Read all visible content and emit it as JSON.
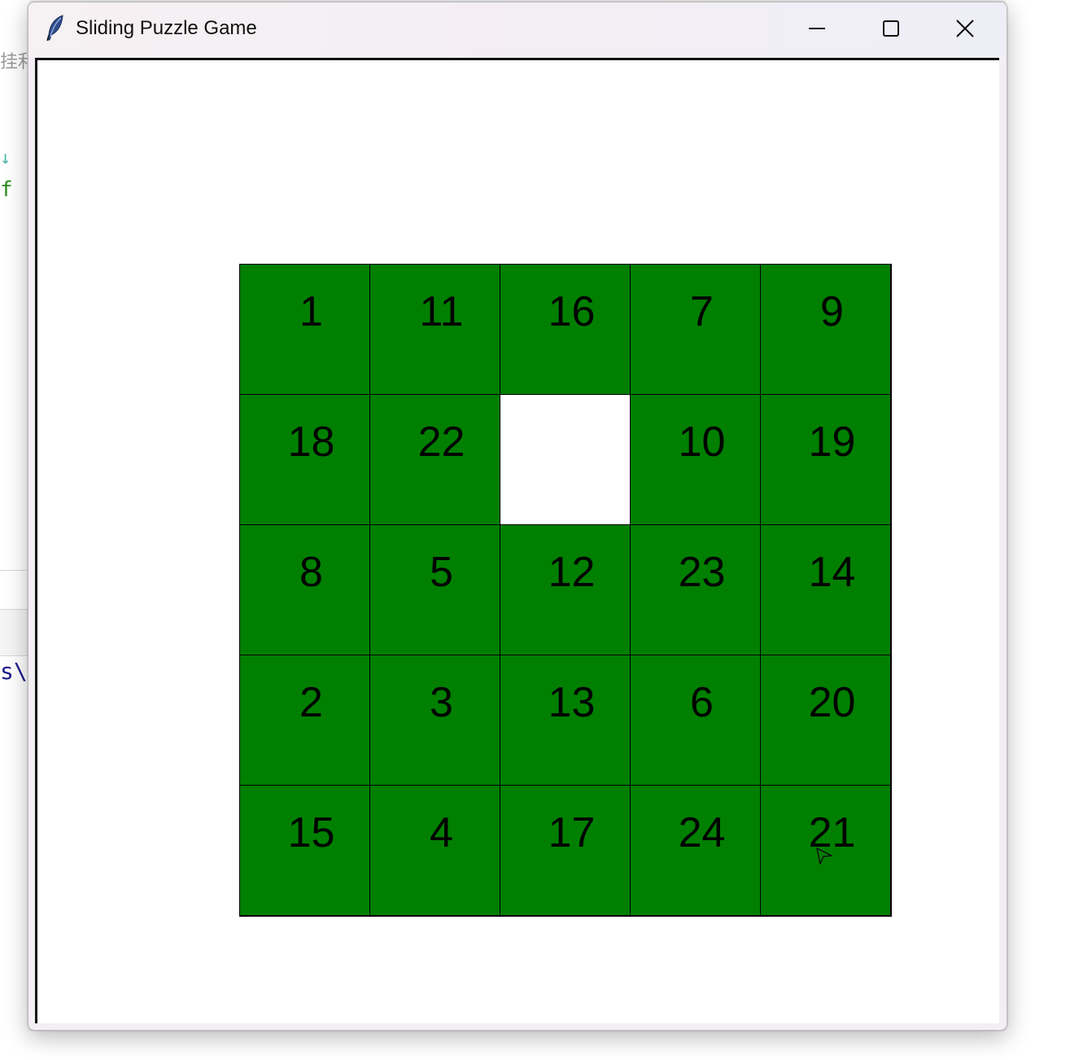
{
  "background": {
    "cjk_fragment": "挂利",
    "arrow_glyph": "↓",
    "code_fragment_f": "f",
    "code_fragment_s": "s\\"
  },
  "window": {
    "title": "Sliding Puzzle Game",
    "app_icon": "feather-icon",
    "controls": {
      "minimize": "minimize-icon",
      "maximize": "maximize-icon",
      "close": "close-icon"
    }
  },
  "puzzle": {
    "rows": 5,
    "cols": 5,
    "tile_color": "#007f00",
    "empty_color": "#ffffff",
    "tiles": [
      [
        "1",
        "11",
        "16",
        "7",
        "9"
      ],
      [
        "18",
        "22",
        "",
        "10",
        "19"
      ],
      [
        "8",
        "5",
        "12",
        "23",
        "14"
      ],
      [
        "2",
        "3",
        "13",
        "6",
        "20"
      ],
      [
        "15",
        "4",
        "17",
        "24",
        "21"
      ]
    ]
  }
}
